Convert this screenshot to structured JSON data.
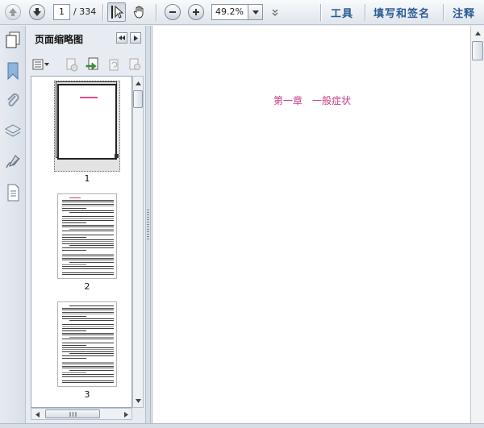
{
  "toolbar": {
    "page_current": "1",
    "page_total": "/ 334",
    "zoom_value": "49.2%",
    "tools_label": "工具",
    "fill_sign_label": "填写和签名",
    "comment_label": "注释"
  },
  "panel": {
    "title": "页面缩略图",
    "thumbnails": [
      {
        "label": "1"
      },
      {
        "label": "2"
      },
      {
        "label": "3"
      }
    ]
  },
  "document": {
    "chapter_title": "第一章　一般症状"
  },
  "colors": {
    "accent_text": "#2a5a94",
    "chapter_pink": "#c63c86"
  }
}
